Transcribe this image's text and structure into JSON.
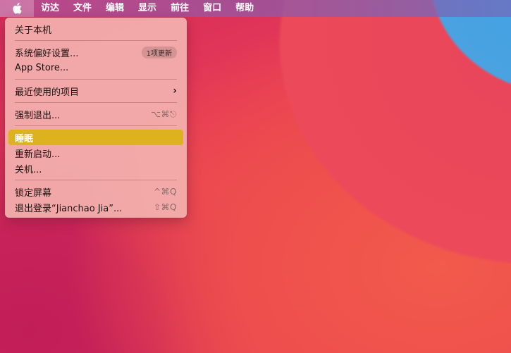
{
  "menubar": {
    "apple_icon": "apple-logo-icon",
    "items": [
      "访达",
      "文件",
      "编辑",
      "显示",
      "前往",
      "窗口",
      "帮助"
    ]
  },
  "apple_menu": {
    "about": "关于本机",
    "system_prefs": "系统偏好设置...",
    "system_prefs_badge": "1项更新",
    "app_store": "App Store...",
    "recent_items": "最近使用的项目",
    "recent_items_icon": "chevron-right-icon",
    "force_quit": "强制退出...",
    "force_quit_shortcut": "⌥⌘⎋",
    "sleep": "睡眠",
    "restart": "重新启动...",
    "shutdown": "关机...",
    "lock_screen": "锁定屏幕",
    "lock_screen_shortcut": "^⌘Q",
    "logout": "退出登录“Jianchao Jia”...",
    "logout_shortcut": "⇧⌘Q",
    "highlight_color": "#dcb21e"
  },
  "colors": {
    "wallpaper_red": "#e8455b",
    "wallpaper_blue": "#4aa3e0"
  }
}
